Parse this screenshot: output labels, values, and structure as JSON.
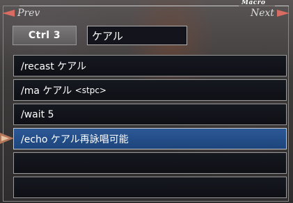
{
  "header": {
    "macro_label": "Macro",
    "prev_label": "Prev",
    "next_label": "Next"
  },
  "macro": {
    "ctrl_label": "Ctrl 3",
    "name": "ケアル",
    "lines": [
      {
        "text": "/recast ケアル"
      },
      {
        "text": "/ma ケアル ",
        "suffix": "<stpc>"
      },
      {
        "text": "/wait 5"
      },
      {
        "text": "/echo ケアル再詠唱可能"
      },
      {
        "text": ""
      },
      {
        "text": ""
      }
    ],
    "selected_line": 4
  },
  "colors": {
    "selected_line": "#1f4a85",
    "line_bg": "#12131a",
    "arrow": "#d86b62"
  }
}
